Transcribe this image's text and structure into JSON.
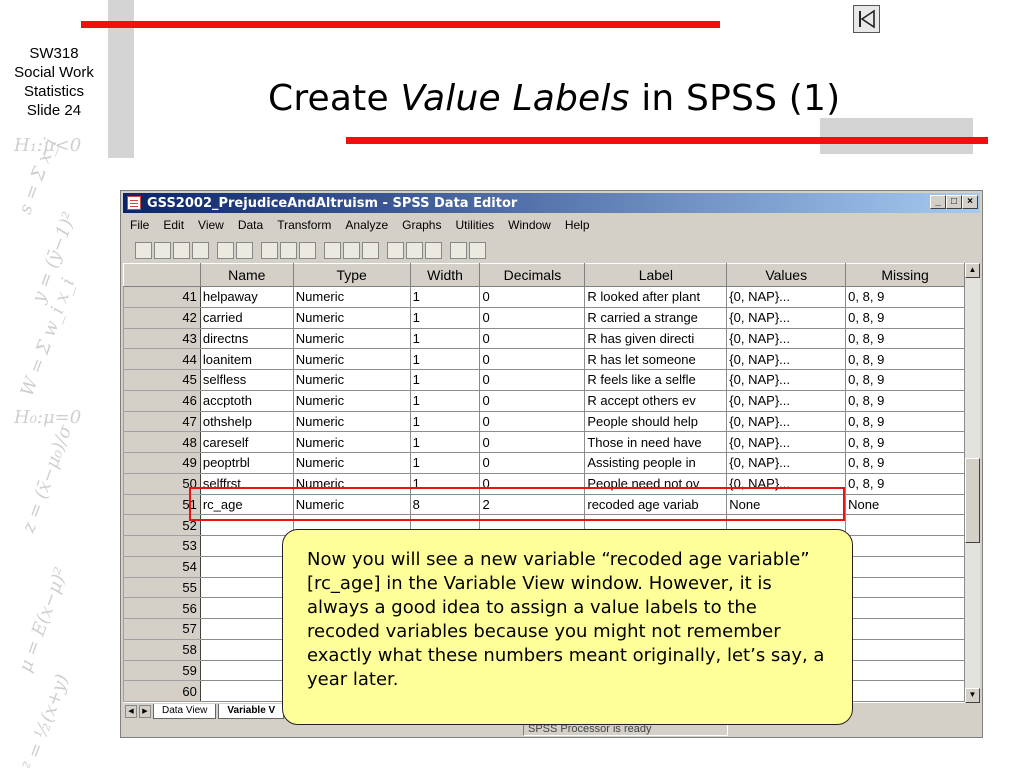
{
  "slide": {
    "course_lines": [
      "SW318",
      "Social Work",
      "Statistics",
      "Slide 24"
    ],
    "title_pre": "Create ",
    "title_italic": "Value Labels",
    "title_post": " in SPSS (1)",
    "nav_icon": "first-slide-icon",
    "colors": {
      "accent_red": "#ee1111",
      "gray": "#d4d4d4",
      "callout": "#ffff99"
    }
  },
  "window": {
    "title": "GSS2002_PrejudiceAndAltruism - SPSS Data Editor",
    "controls": [
      "_",
      "□",
      "×"
    ],
    "menu": [
      "File",
      "Edit",
      "View",
      "Data",
      "Transform",
      "Analyze",
      "Graphs",
      "Utilities",
      "Window",
      "Help"
    ],
    "columns": [
      "Name",
      "Type",
      "Width",
      "Decimals",
      "Label",
      "Values",
      "Missing"
    ],
    "rows": [
      {
        "n": "41",
        "name": "helpaway",
        "type": "Numeric",
        "width": "1",
        "decimals": "0",
        "label": "R looked after plant",
        "values": "{0, NAP}...",
        "missing": "0, 8, 9"
      },
      {
        "n": "42",
        "name": "carried",
        "type": "Numeric",
        "width": "1",
        "decimals": "0",
        "label": "R carried a strange",
        "values": "{0, NAP}...",
        "missing": "0, 8, 9"
      },
      {
        "n": "43",
        "name": "directns",
        "type": "Numeric",
        "width": "1",
        "decimals": "0",
        "label": "R has given directi",
        "values": "{0, NAP}...",
        "missing": "0, 8, 9"
      },
      {
        "n": "44",
        "name": "loanitem",
        "type": "Numeric",
        "width": "1",
        "decimals": "0",
        "label": "R has let someone",
        "values": "{0, NAP}...",
        "missing": "0, 8, 9"
      },
      {
        "n": "45",
        "name": "selfless",
        "type": "Numeric",
        "width": "1",
        "decimals": "0",
        "label": "R feels like a selfle",
        "values": "{0, NAP}...",
        "missing": "0, 8, 9"
      },
      {
        "n": "46",
        "name": "accptoth",
        "type": "Numeric",
        "width": "1",
        "decimals": "0",
        "label": "R accept others ev",
        "values": "{0, NAP}...",
        "missing": "0, 8, 9"
      },
      {
        "n": "47",
        "name": "othshelp",
        "type": "Numeric",
        "width": "1",
        "decimals": "0",
        "label": "People should help",
        "values": "{0, NAP}...",
        "missing": "0, 8, 9"
      },
      {
        "n": "48",
        "name": "careself",
        "type": "Numeric",
        "width": "1",
        "decimals": "0",
        "label": "Those in need have",
        "values": "{0, NAP}...",
        "missing": "0, 8, 9"
      },
      {
        "n": "49",
        "name": "peoptrbl",
        "type": "Numeric",
        "width": "1",
        "decimals": "0",
        "label": "Assisting people in",
        "values": "{0, NAP}...",
        "missing": "0, 8, 9"
      },
      {
        "n": "50",
        "name": "selffrst",
        "type": "Numeric",
        "width": "1",
        "decimals": "0",
        "label": "People need not ov",
        "values": "{0, NAP}...",
        "missing": "0, 8, 9"
      },
      {
        "n": "51",
        "name": "rc_age",
        "type": "Numeric",
        "width": "8",
        "decimals": "2",
        "label": "recoded age variab",
        "values": "None",
        "missing": "None"
      }
    ],
    "empty_rows": [
      "52",
      "53",
      "54",
      "55",
      "56",
      "57",
      "58",
      "59",
      "60"
    ],
    "tabs": [
      "Data View",
      "Variable V"
    ],
    "status": "SPSS Processor  is ready"
  },
  "callout": {
    "text": "Now you will see a new variable “recoded age variable” [rc_age] in the Variable View window. However, it is always a good idea to assign a value labels to the recoded variables because you might not remember exactly what these numbers meant originally, let’s say, a year later."
  }
}
